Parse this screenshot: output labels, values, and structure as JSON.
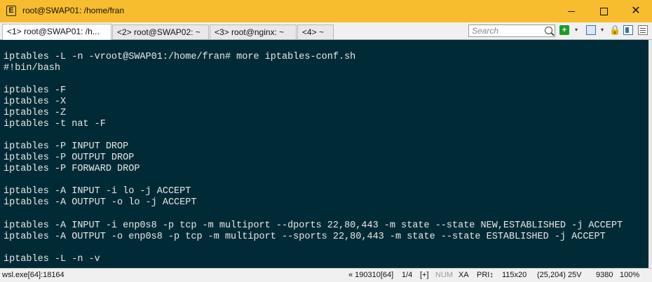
{
  "window": {
    "title": "root@SWAP01: /home/fran",
    "app_icon": "E"
  },
  "tabs": [
    {
      "label": "<1> root@SWAP01: /h..."
    },
    {
      "label": "<2> root@SWAP02: ~"
    },
    {
      "label": "<3> root@nginx: ~"
    },
    {
      "label": "<4> ~"
    }
  ],
  "toolbar": {
    "search_placeholder": "Search",
    "drop": "▾",
    "lock": "🔒"
  },
  "terminal": {
    "lines": [
      "iptables -L -n -vroot@SWAP01:/home/fran# more iptables-conf.sh",
      "#!bin/bash",
      "",
      "iptables -F",
      "iptables -X",
      "iptables -Z",
      "iptables -t nat -F",
      "",
      "iptables -P INPUT DROP",
      "iptables -P OUTPUT DROP",
      "iptables -P FORWARD DROP",
      "",
      "iptables -A INPUT -i lo -j ACCEPT",
      "iptables -A OUTPUT -o lo -j ACCEPT",
      "",
      "iptables -A INPUT -i enp0s8 -p tcp -m multiport --dports 22,80,443 -m state --state NEW,ESTABLISHED -j ACCEPT",
      "iptables -A OUTPUT -o enp0s8 -p tcp -m multiport --sports 22,80,443 -m state --state ESTABLISHED -j ACCEPT",
      "",
      "iptables -L -n -v"
    ],
    "bg_color": "#002b36",
    "fg_color": "#e8e8e8"
  },
  "status": {
    "process": "wsl.exe[64]:18164",
    "build": "« 190310[64]",
    "console": "1/4",
    "plus": "[+]",
    "num": "NUM",
    "xa": "XA",
    "pri": "PRI↕",
    "size": "115x20",
    "cursor": "(25,204) 25V",
    "buffer": "9380",
    "zoom": "100%"
  },
  "colors": {
    "titlebar": "#f7bd2e",
    "terminal_bg": "#002b36"
  }
}
